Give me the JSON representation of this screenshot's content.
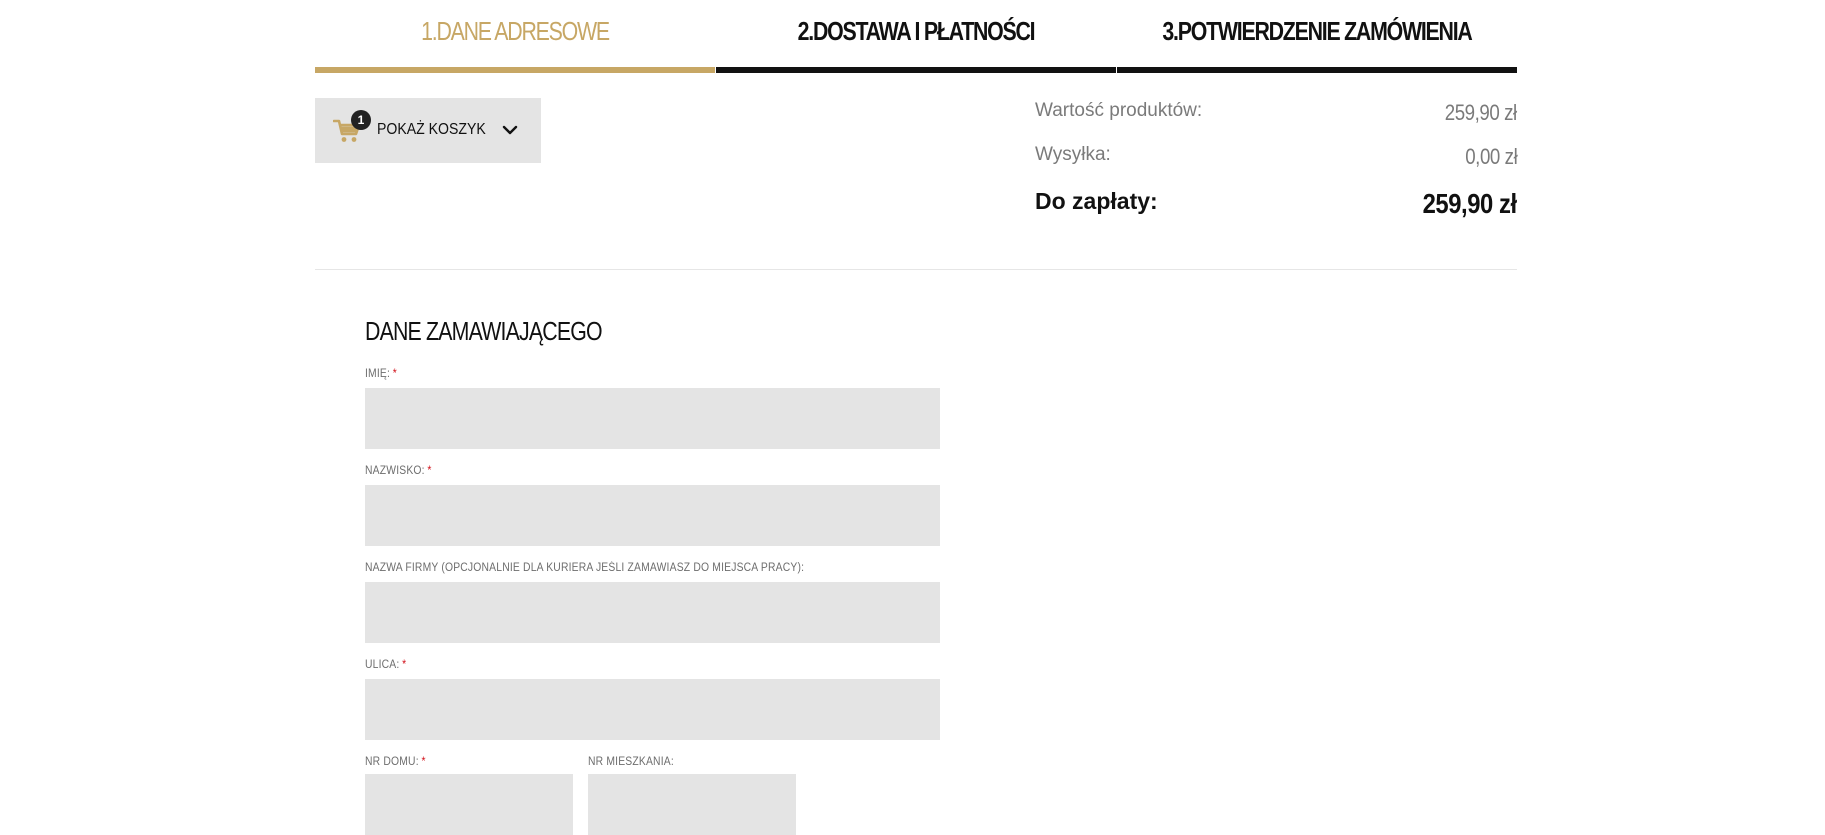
{
  "steps": [
    {
      "label": "1.DANE ADRESOWE",
      "active": true
    },
    {
      "label": "2.DOSTAWA I PŁATNOŚCI",
      "active": false
    },
    {
      "label": "3.POTWIERDZENIE ZAMÓWIENIA",
      "active": false
    }
  ],
  "cart": {
    "count": "1",
    "label": "POKAŻ KOSZYK",
    "icon": "cart-icon",
    "toggle_icon": "chevron-down-icon"
  },
  "summary": {
    "products_label": "Wartość produktów:",
    "products_value": "259,90 zł",
    "shipping_label": "Wysyłka:",
    "shipping_value": "0,00 zł",
    "total_label": "Do zapłaty:",
    "total_value": "259,90 zł"
  },
  "form": {
    "title": "DANE ZAMAWIAJĄCEGO",
    "required_mark": "*",
    "first_name": {
      "label": "IMIĘ:",
      "value": ""
    },
    "last_name": {
      "label": "NAZWISKO:",
      "value": ""
    },
    "company": {
      "label": "NAZWA FIRMY (OPCJONALNIE DLA KURIERA JEŚLI ZAMAWIASZ DO MIEJSCA PRACY):",
      "value": ""
    },
    "street": {
      "label": "ULICA:",
      "value": ""
    },
    "house_no": {
      "label": "NR DOMU:",
      "value": ""
    },
    "apartment_no": {
      "label": "NR MIESZKANIA:",
      "value": ""
    }
  },
  "colors": {
    "accent": "#c7a765",
    "dark": "#111111",
    "field_bg": "#e4e4e4",
    "required": "#d2121b"
  }
}
